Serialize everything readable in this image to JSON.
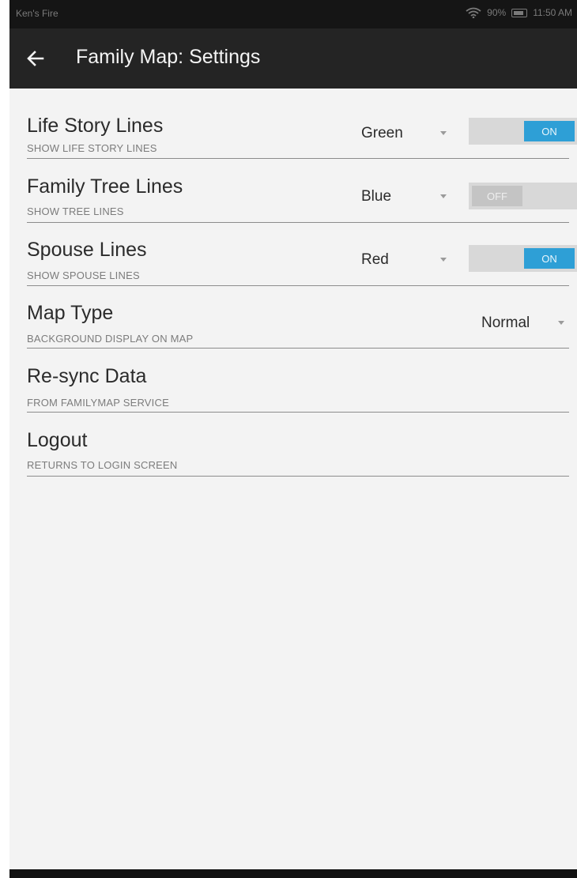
{
  "status_bar": {
    "device_name": "Ken's Fire",
    "battery_percent": "90%",
    "battery_icon": "battery-icon",
    "wifi_icon": "wifi-icon",
    "time": "11:50 AM"
  },
  "action_bar": {
    "back_icon": "back-arrow-icon",
    "title": "Family Map: Settings"
  },
  "settings": [
    {
      "title": "Life Story Lines",
      "subtitle": "SHOW LIFE STORY LINES",
      "color": "Green",
      "toggle": "ON",
      "toggle_state": true
    },
    {
      "title": "Family Tree Lines",
      "subtitle": "SHOW TREE LINES",
      "color": "Blue",
      "toggle": "OFF",
      "toggle_state": false
    },
    {
      "title": "Spouse Lines",
      "subtitle": "SHOW SPOUSE LINES",
      "color": "Red",
      "toggle": "ON",
      "toggle_state": true
    },
    {
      "title": "Map Type",
      "subtitle": "BACKGROUND DISPLAY ON MAP",
      "value": "Normal"
    },
    {
      "title": "Re-sync Data",
      "subtitle": "FROM FAMILYMAP SERVICE"
    },
    {
      "title": "Logout",
      "subtitle": "RETURNS TO LOGIN SCREEN"
    }
  ],
  "colors": {
    "accent_on": "#2e9fd6",
    "action_bar": "#242424",
    "status_bar": "#151515",
    "background": "#f3f3f3"
  }
}
